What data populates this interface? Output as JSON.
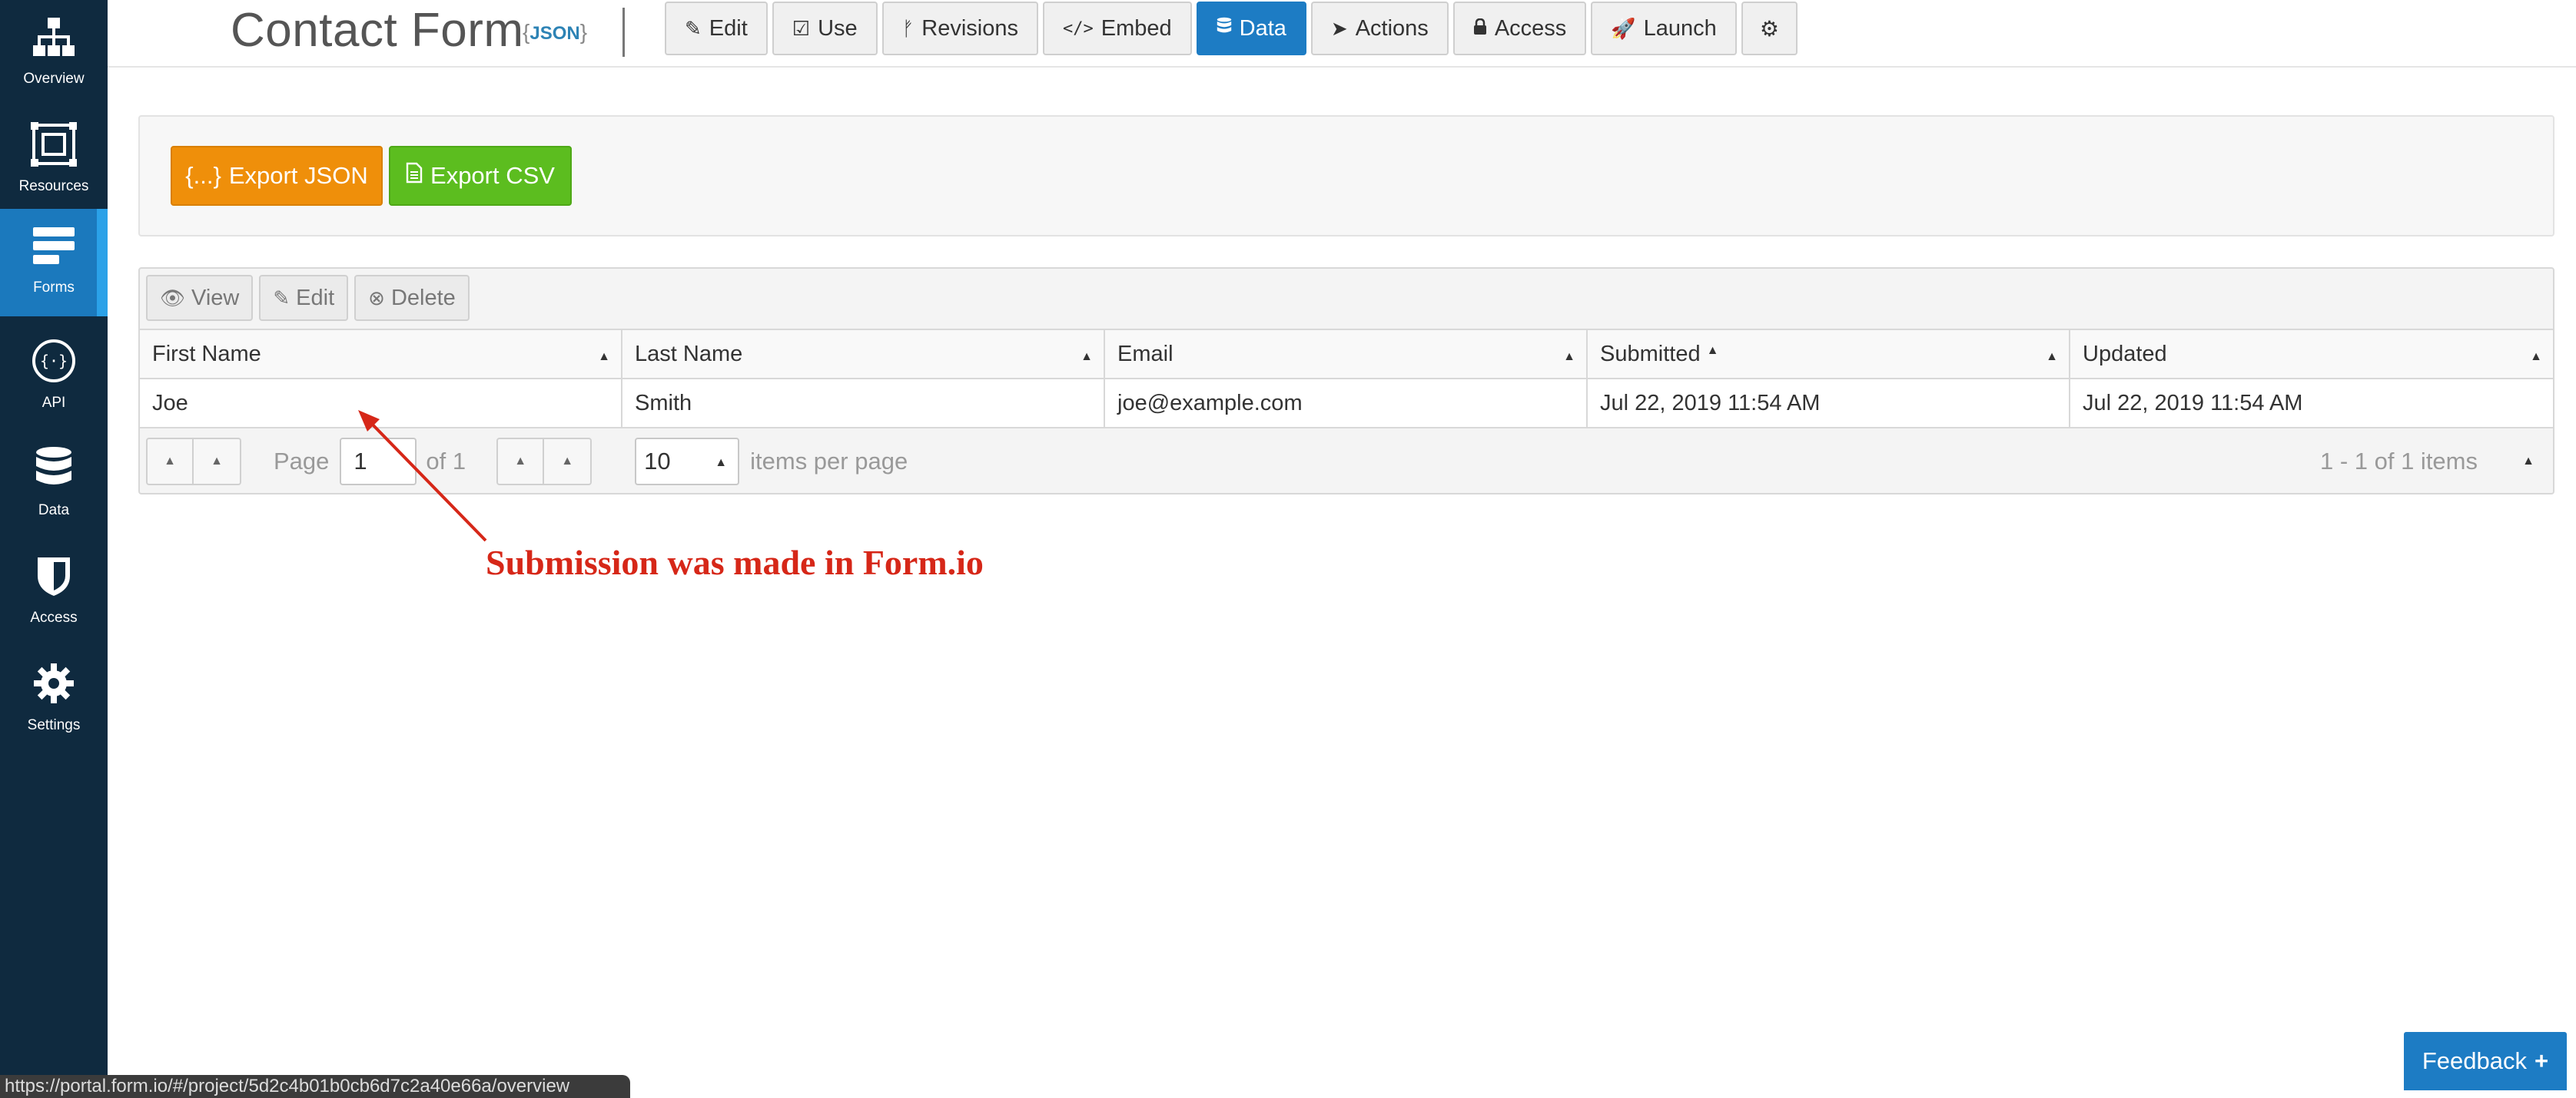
{
  "sidebar": {
    "items": [
      {
        "label": "Overview",
        "icon": "sitemap-icon"
      },
      {
        "label": "Resources",
        "icon": "resources-icon"
      },
      {
        "label": "Forms",
        "icon": "forms-icon",
        "active": true
      },
      {
        "label": "API",
        "icon": "api-icon"
      },
      {
        "label": "Data",
        "icon": "database-icon"
      },
      {
        "label": "Access",
        "icon": "shield-icon"
      },
      {
        "label": "Settings",
        "icon": "gear-icon"
      }
    ]
  },
  "header": {
    "title": "Contact Form",
    "json_badge_open": "{",
    "json_badge_text": "JSON",
    "json_badge_close": "}",
    "tabs": [
      {
        "label": "Edit",
        "icon": "edit-icon"
      },
      {
        "label": "Use",
        "icon": "check-square-icon"
      },
      {
        "label": "Revisions",
        "icon": "branch-icon"
      },
      {
        "label": "Embed",
        "icon": "code-icon"
      },
      {
        "label": "Data",
        "icon": "database-icon",
        "active": true
      },
      {
        "label": "Actions",
        "icon": "paper-plane-icon"
      },
      {
        "label": "Access",
        "icon": "lock-icon"
      },
      {
        "label": "Launch",
        "icon": "rocket-icon"
      },
      {
        "label": "",
        "icon": "gear-icon"
      }
    ]
  },
  "export": {
    "json_label": "Export JSON",
    "json_icon_text": "{...}",
    "csv_label": "Export CSV",
    "json_color": "#ef8f0a",
    "csv_color": "#5cbd1f"
  },
  "grid": {
    "toolbar": [
      {
        "label": "View",
        "icon": "eye-icon"
      },
      {
        "label": "Edit",
        "icon": "edit-icon"
      },
      {
        "label": "Delete",
        "icon": "times-circle-icon"
      }
    ],
    "columns": [
      "First Name",
      "Last Name",
      "Email",
      "Submitted",
      "Updated"
    ],
    "rows": [
      [
        "Joe",
        "Smith",
        "joe@example.com",
        "Jul 22, 2019 11:54 AM",
        "Jul 22, 2019 11:54 AM"
      ]
    ],
    "pager": {
      "page_label": "Page",
      "page_value": "1",
      "of_label": "of 1",
      "page_size": "10",
      "items_per_page_label": "items per page",
      "count_label": "1 - 1 of 1 items"
    }
  },
  "annotation": {
    "text": "Submission was made in Form.io",
    "color": "#d62718"
  },
  "status_bar": {
    "url": "https://portal.form.io/#/project/5d2c4b01b0cb6d7c2a40e66a/overview"
  },
  "feedback": {
    "label": "Feedback",
    "icon_text": "+"
  }
}
